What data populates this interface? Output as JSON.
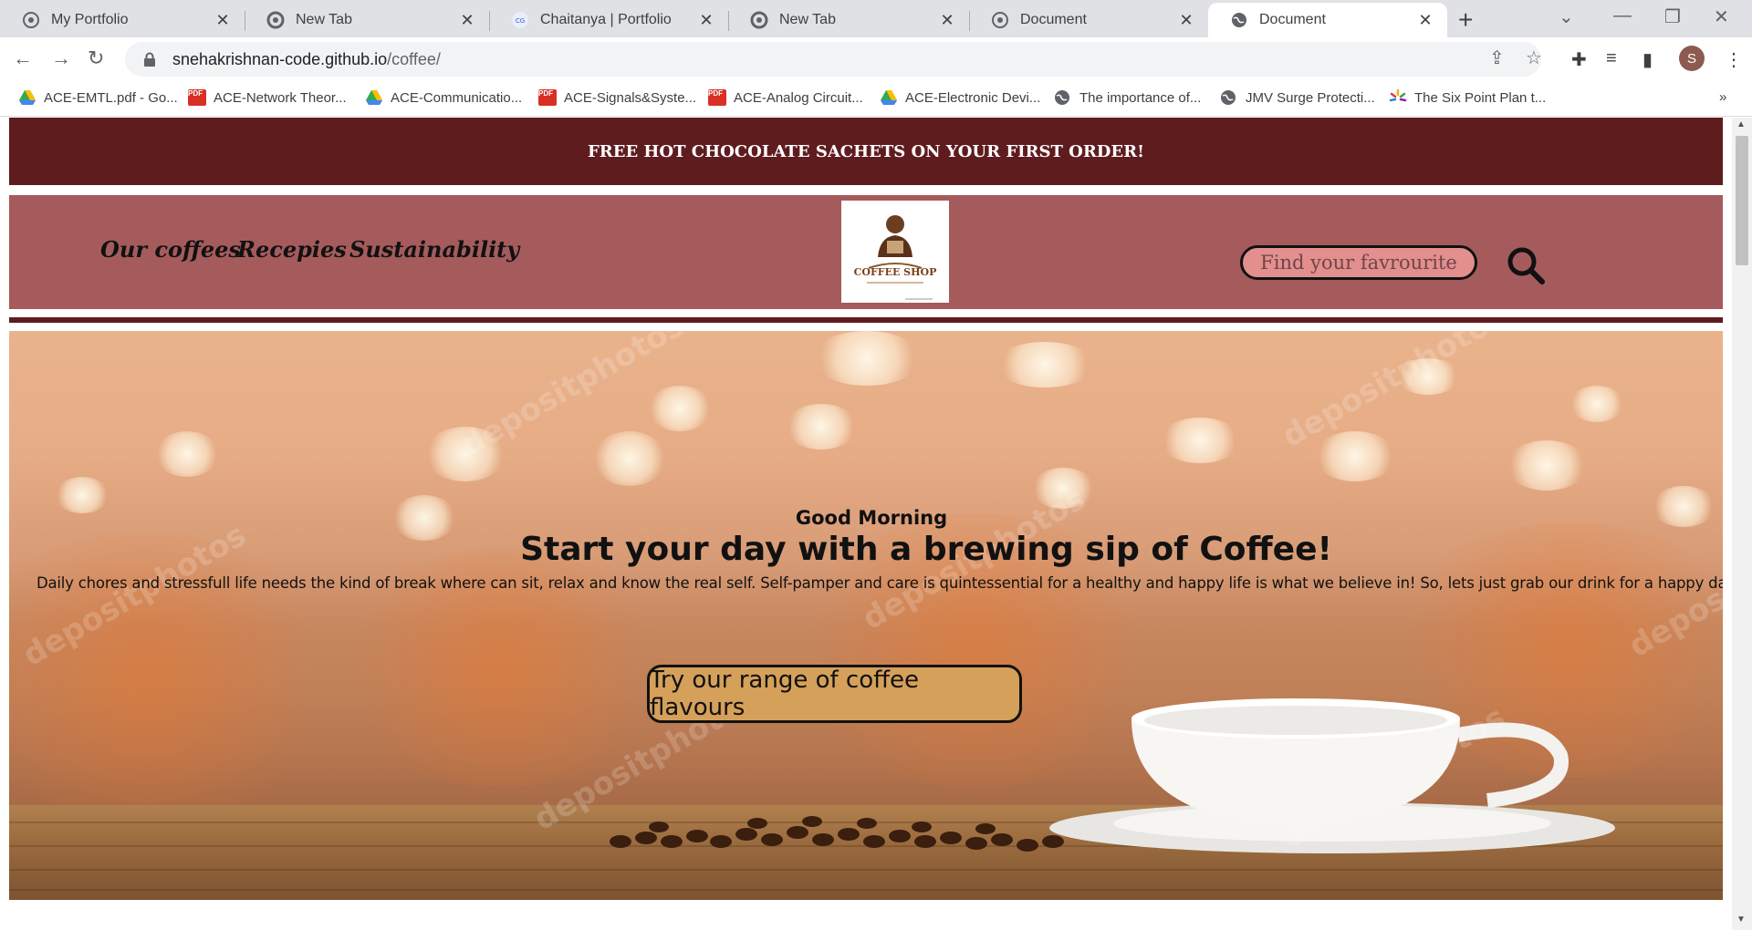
{
  "browser": {
    "tabs": [
      {
        "title": "My Portfolio",
        "icon": "podcast-icon"
      },
      {
        "title": "New Tab",
        "icon": "chrome-icon"
      },
      {
        "title": "Chaitanya | Portfolio",
        "icon": "cg-icon"
      },
      {
        "title": "New Tab",
        "icon": "chrome-icon"
      },
      {
        "title": "Document",
        "icon": "podcast-icon"
      },
      {
        "title": "Document",
        "icon": "globe-icon",
        "active": true
      }
    ],
    "url_host": "snehakrishnan-code.github.io",
    "url_path": "/coffee/",
    "profile_initial": "S",
    "bookmarks": [
      {
        "label": "ACE-EMTL.pdf - Go...",
        "icon": "drive-icon"
      },
      {
        "label": "ACE-Network Theor...",
        "icon": "pdf-icon"
      },
      {
        "label": "ACE-Communicatio...",
        "icon": "drive-icon"
      },
      {
        "label": "ACE-Signals&Syste...",
        "icon": "pdf-icon"
      },
      {
        "label": "ACE-Analog Circuit...",
        "icon": "pdf-icon"
      },
      {
        "label": "ACE-Electronic Devi...",
        "icon": "drive-icon"
      },
      {
        "label": "The importance of...",
        "icon": "globe-icon"
      },
      {
        "label": "JMV Surge Protecti...",
        "icon": "globe-icon"
      },
      {
        "label": "The Six Point Plan t...",
        "icon": "sparkle-icon"
      }
    ],
    "pdf_badge": "PDF",
    "more_bookmarks": "»"
  },
  "site": {
    "promo": "FREE HOT CHOCOLATE SACHETS ON YOUR FIRST ORDER!",
    "nav": [
      "Our coffees",
      "Recepies",
      "Sustainability"
    ],
    "logo_text": "COFFEE SHOP",
    "search_placeholder": "Find your favrourite",
    "hero": {
      "greeting": "Good Morning",
      "headline": "Start your day with a brewing sip of Coffee!",
      "body": "Daily chores and stressfull life needs the kind of break where can sit, relax and know the real self. Self-pamper and care is quintessential for a healthy and happy life is what we believe in! So, lets just grab our drink for a happy day!",
      "cta": "Try our range of coffee flavours"
    },
    "watermark": "depositphotos",
    "colors": {
      "promo_bg": "#5f1c1f",
      "header_bg": "#a55b5c",
      "search_bg": "#e28f8e",
      "cta_bg": "#d5a05a"
    }
  }
}
